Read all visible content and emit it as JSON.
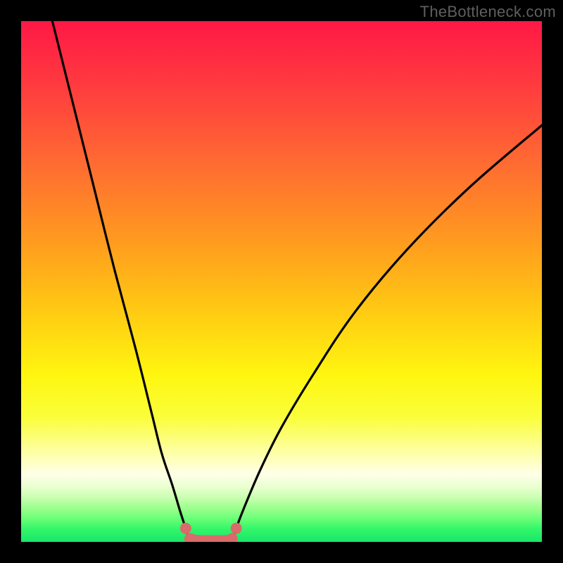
{
  "watermark": "TheBottleneck.com",
  "colors": {
    "frame": "#000000",
    "watermark": "#5f5f5f",
    "curve": "#000000",
    "accent": "#d96b6b",
    "gradient_stops": [
      {
        "offset": 0.0,
        "color": "#ff1846"
      },
      {
        "offset": 0.12,
        "color": "#ff3a3f"
      },
      {
        "offset": 0.27,
        "color": "#ff6a32"
      },
      {
        "offset": 0.42,
        "color": "#ff9a1f"
      },
      {
        "offset": 0.55,
        "color": "#ffc813"
      },
      {
        "offset": 0.68,
        "color": "#fff610"
      },
      {
        "offset": 0.76,
        "color": "#fafe3a"
      },
      {
        "offset": 0.835,
        "color": "#feffb0"
      },
      {
        "offset": 0.87,
        "color": "#ffffe8"
      },
      {
        "offset": 0.895,
        "color": "#e9ffcf"
      },
      {
        "offset": 0.915,
        "color": "#c8ffb0"
      },
      {
        "offset": 0.935,
        "color": "#9cff8e"
      },
      {
        "offset": 0.955,
        "color": "#6bff78"
      },
      {
        "offset": 0.975,
        "color": "#34f56a"
      },
      {
        "offset": 1.0,
        "color": "#17e86a"
      }
    ]
  },
  "chart_data": {
    "type": "line",
    "title": "",
    "xlabel": "",
    "ylabel": "",
    "x_range": [
      0,
      100
    ],
    "y_range": [
      0,
      100
    ],
    "series": [
      {
        "name": "left-branch",
        "x": [
          6,
          10,
          14,
          18,
          22,
          25,
          27,
          29,
          30.5,
          31.6,
          32.4
        ],
        "y": [
          100,
          84,
          68,
          52,
          37,
          25,
          17,
          11,
          6,
          2.6,
          0
        ]
      },
      {
        "name": "right-branch",
        "x": [
          40.5,
          41.3,
          43,
          46,
          50,
          56,
          64,
          74,
          86,
          100
        ],
        "y": [
          0,
          2.6,
          7,
          14,
          22,
          32,
          44,
          56,
          68,
          80
        ]
      },
      {
        "name": "valley-floor",
        "x": [
          32.4,
          33.5,
          35,
          37,
          39,
          40.2,
          40.5
        ],
        "y": [
          0,
          0,
          0,
          0,
          0,
          0,
          0
        ]
      }
    ],
    "accent_markers": {
      "name": "valley-accent",
      "comment": "thick pink/red segment + two dots near valley",
      "dots_x": [
        31.6,
        41.3
      ],
      "dots_y": [
        2.6,
        2.6
      ],
      "band_x": [
        32.4,
        33.5,
        35,
        37,
        39,
        40.2,
        40.5
      ],
      "band_y": [
        0.6,
        0.3,
        0.2,
        0.2,
        0.2,
        0.3,
        0.6
      ]
    }
  }
}
